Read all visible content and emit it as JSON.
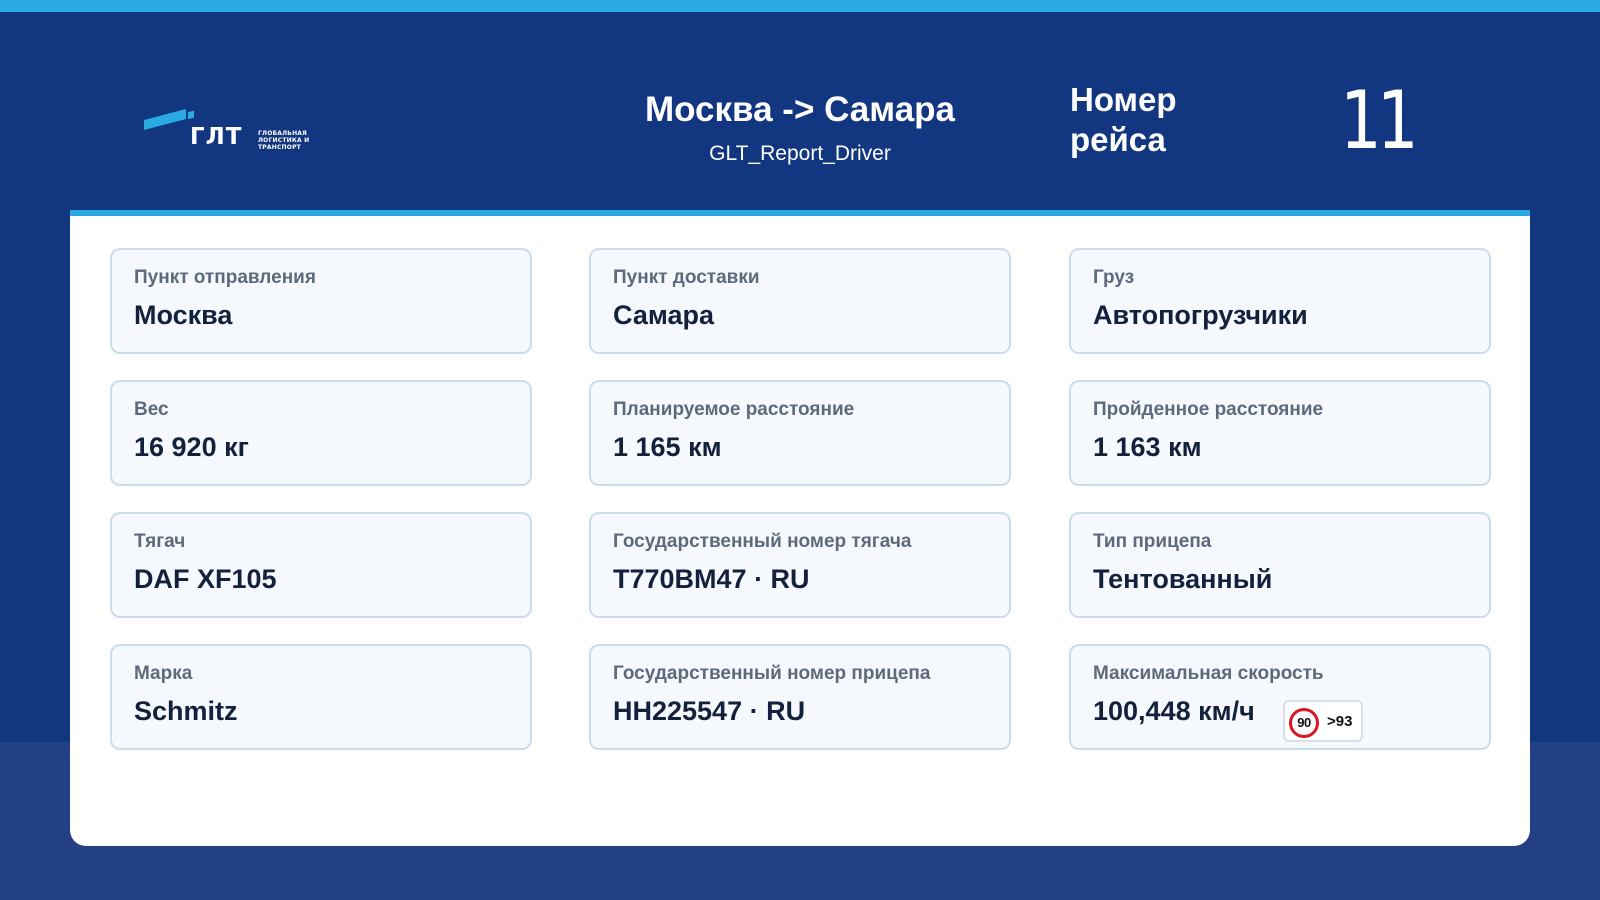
{
  "header": {
    "logo": {
      "word": "ГЛТ",
      "tagline": [
        "ГЛОБАЛЬНАЯ",
        "ЛОГИСТИКА И",
        "ТРАНСПОРТ"
      ]
    },
    "route_title": "Москва -> Самара",
    "report_name": "GLT_Report_Driver",
    "trip_label": "Номер рейса",
    "trip_number": "11"
  },
  "cards": [
    {
      "label": "Пункт отправления",
      "value": "Москва"
    },
    {
      "label": "Пункт доставки",
      "value": "Самара"
    },
    {
      "label": "Груз",
      "value": "Автопогрузчики"
    },
    {
      "label": "Вес",
      "value": "16 920 кг"
    },
    {
      "label": "Планируемое расстояние",
      "value": "1 165 км"
    },
    {
      "label": "Пройденное расстояние",
      "value": "1 163 км"
    },
    {
      "label": "Тягач",
      "value": "DAF XF105"
    },
    {
      "label": "Государственный номер тягача",
      "value": "T770BM47 · RU"
    },
    {
      "label": "Тип прицепа",
      "value": "Тентованный"
    },
    {
      "label": "Марка",
      "value": "Schmitz"
    },
    {
      "label": "Государственный номер прицепа",
      "value": "HH225547 · RU"
    },
    {
      "label": "Максимальная скорость",
      "value": "100,448 км/ч"
    }
  ],
  "speed_badge": {
    "limit": "90",
    "over": ">93",
    "sign_color": "#d71921"
  },
  "colors": {
    "header_bg": "#133681",
    "accent": "#29abe2",
    "card_bg": "#f5f9fd",
    "card_border": "#cbdced"
  }
}
